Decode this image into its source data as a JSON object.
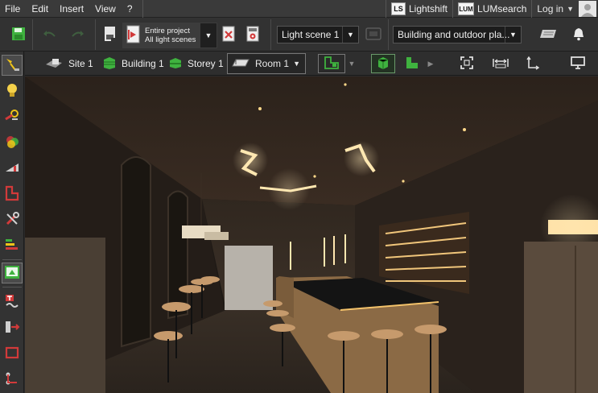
{
  "menu": {
    "items": [
      "File",
      "Edit",
      "Insert",
      "View",
      "?"
    ],
    "lightshift_logo": "LS",
    "lightshift_label": "Lightshift",
    "lumsearch_logo": "LUM",
    "lumsearch_label": "LUMsearch",
    "login_label": "Log in"
  },
  "toolbar": {
    "project_line1": "Entire project",
    "project_line2": "All light scenes",
    "light_scene": "Light scene 1",
    "view_mode": "Building and outdoor pla..."
  },
  "breadcrumb": {
    "site": "Site 1",
    "building": "Building 1",
    "storey": "Storey 1",
    "room": "Room 1"
  },
  "icons": {
    "save": "save-icon",
    "undo": "undo-icon",
    "redo": "redo-icon",
    "project": "project-document-icon",
    "delete": "delete-icon",
    "calculate": "calculate-icon",
    "notification": "bell-icon",
    "keyboard": "keyboard-icon"
  },
  "colors": {
    "accent_green": "#3fb23f",
    "toolbar_bg": "#323232",
    "icon_red": "#d23a3a",
    "icon_yellow": "#f0c419"
  }
}
